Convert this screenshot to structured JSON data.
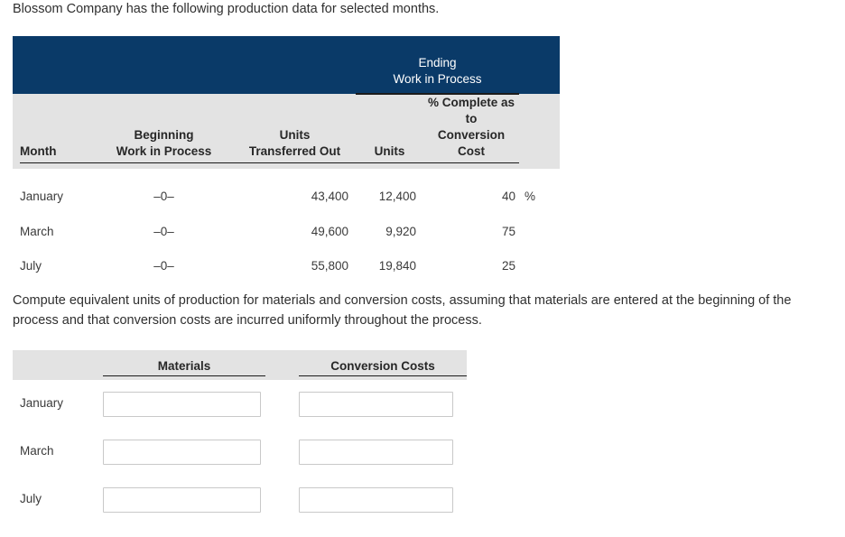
{
  "intro": {
    "text": "Blossom Company has the following production data for selected months."
  },
  "production_table": {
    "group_header": {
      "line1": "Ending",
      "line2": "Work in Process"
    },
    "columns": [
      {
        "line1": "",
        "line2": "Month"
      },
      {
        "line1": "Beginning",
        "line2": "Work in Process"
      },
      {
        "line1": "Units",
        "line2": "Transferred Out"
      },
      {
        "line1": "",
        "line2": "Units"
      },
      {
        "line1": "% Complete as to",
        "line2": "Conversion Cost"
      }
    ],
    "rows": [
      {
        "month": "January",
        "beginning_wip": "–0–",
        "units_transferred_out": "43,400",
        "ending_wip_units": "12,400",
        "pct_complete_conversion": "40",
        "pct_symbol": "%"
      },
      {
        "month": "March",
        "beginning_wip": "–0–",
        "units_transferred_out": "49,600",
        "ending_wip_units": "9,920",
        "pct_complete_conversion": "75",
        "pct_symbol": ""
      },
      {
        "month": "July",
        "beginning_wip": "–0–",
        "units_transferred_out": "55,800",
        "ending_wip_units": "19,840",
        "pct_complete_conversion": "25",
        "pct_symbol": ""
      }
    ]
  },
  "question": {
    "text": "Compute equivalent units of production for materials and conversion costs, assuming that materials are entered at the beginning of the process and that conversion costs are incurred uniformly throughout the process."
  },
  "answer_table": {
    "columns": [
      "Materials",
      "Conversion Costs"
    ],
    "rows": [
      {
        "month": "January",
        "materials_value": "",
        "conversion_value": ""
      },
      {
        "month": "March",
        "materials_value": "",
        "conversion_value": ""
      },
      {
        "month": "July",
        "materials_value": "",
        "conversion_value": ""
      }
    ]
  },
  "colors": {
    "header_navy": "#0a3a68",
    "band_grey": "#e3e3e3",
    "text_dark": "#333333",
    "input_border": "#c9c9c9"
  }
}
